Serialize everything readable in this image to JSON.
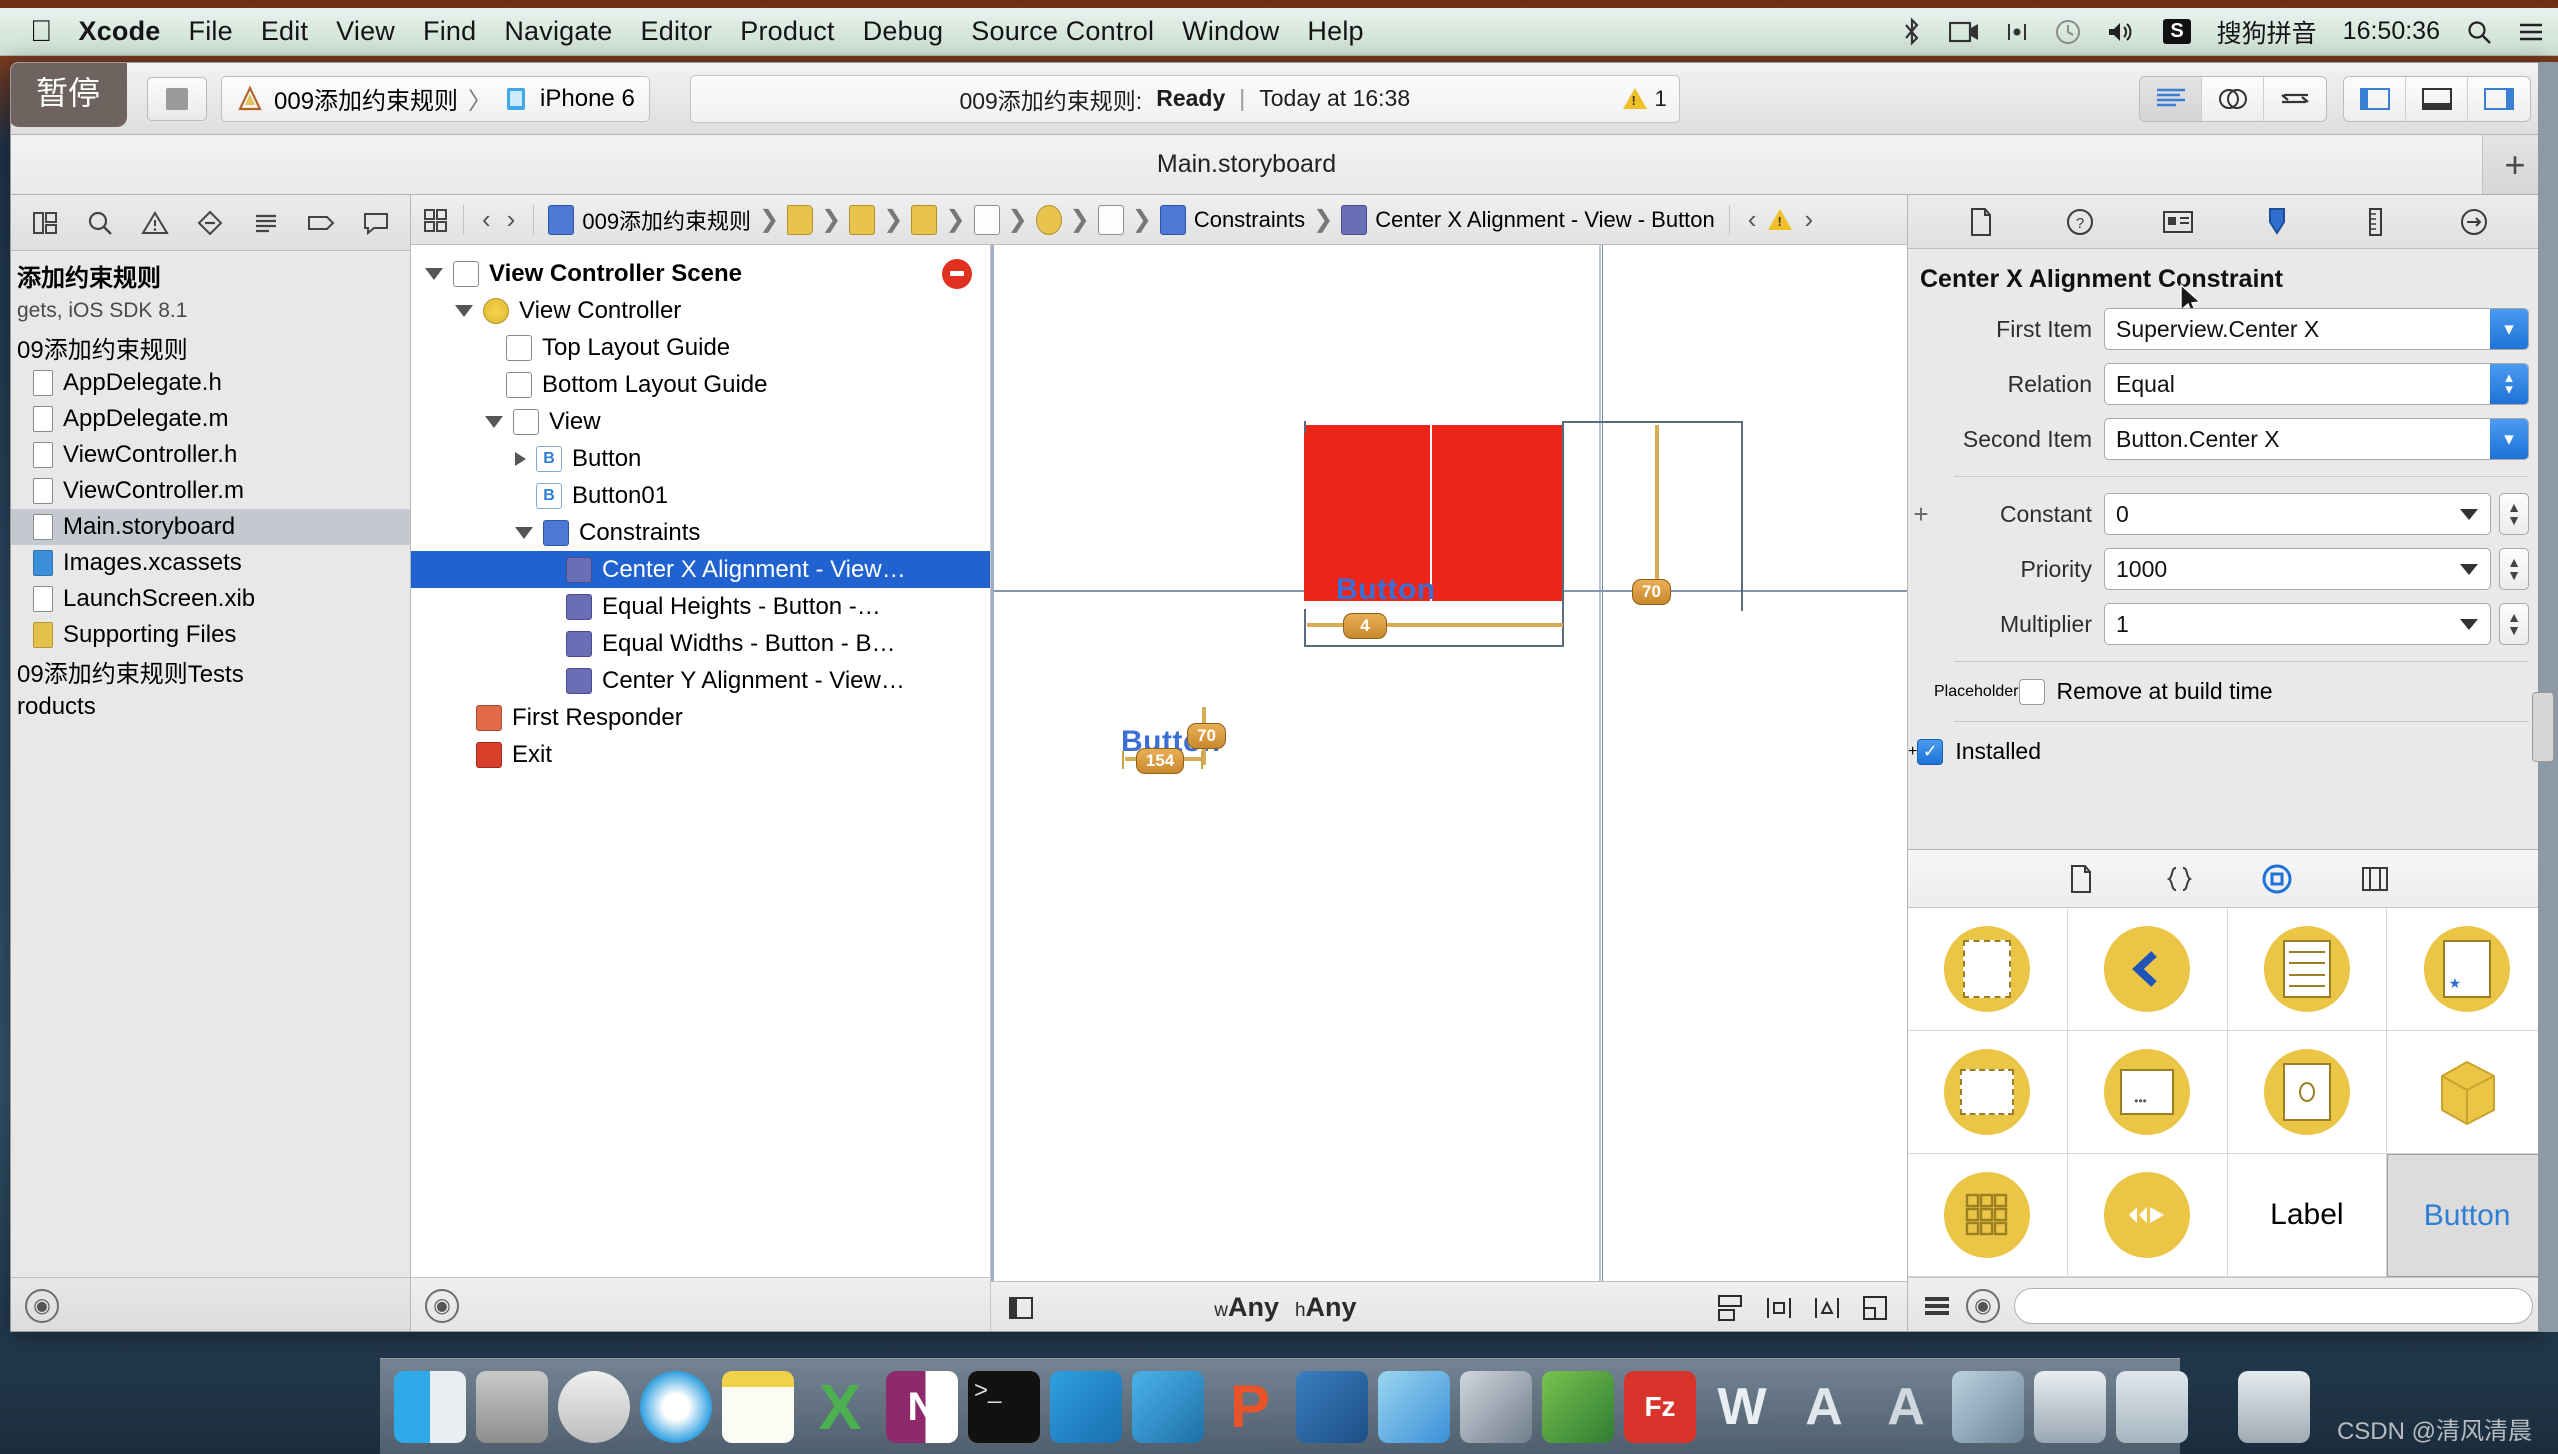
{
  "menubar": {
    "apple_icon": "apple-logo-icon",
    "items": [
      "Xcode",
      "File",
      "Edit",
      "View",
      "Find",
      "Navigate",
      "Editor",
      "Product",
      "Debug",
      "Source Control",
      "Window",
      "Help"
    ],
    "status_icons": [
      "bluetooth-icon",
      "screen-recording-icon",
      "airplay-icon",
      "time-machine-icon",
      "volume-icon"
    ],
    "input_method_badge": "S",
    "input_method": "搜狗拼音",
    "clock": "16:50:36",
    "search_icon": "spotlight-search-icon",
    "notification_icon": "notification-center-icon"
  },
  "tooltip": {
    "pause_label": "暂停"
  },
  "toolbar": {
    "stop_button": "stop-button",
    "scheme_project": "009添加约束规则",
    "scheme_separator": "〉",
    "scheme_device": "iPhone 6",
    "activity_project": "009添加约束规则:",
    "activity_status": "Ready",
    "activity_divider": "|",
    "activity_time": "Today at 16:38",
    "warning_count": "1",
    "editor_modes": [
      "standard-editor-icon",
      "assistant-editor-icon",
      "version-editor-icon"
    ],
    "view_toggles": [
      "toggle-navigator-icon",
      "toggle-debug-area-icon",
      "toggle-utilities-icon"
    ]
  },
  "tabbar": {
    "tab_title": "Main.storyboard",
    "add_tab": "+"
  },
  "navigator": {
    "tabs": [
      "project-navigator-icon",
      "search-navigator-icon",
      "issue-navigator-icon",
      "test-navigator-icon",
      "debug-navigator-icon",
      "breakpoint-navigator-icon",
      "report-navigator-icon"
    ],
    "items": [
      {
        "label": "添加约束规则",
        "kind": "project",
        "bold": true,
        "indent": 0
      },
      {
        "label": "gets, iOS SDK 8.1",
        "kind": "subtitle",
        "indent": 0
      },
      {
        "label": "09添加约束规则",
        "kind": "group",
        "indent": 0
      },
      {
        "label": "AppDelegate.h",
        "kind": "file",
        "indent": 1
      },
      {
        "label": "AppDelegate.m",
        "kind": "file",
        "indent": 1
      },
      {
        "label": "ViewController.h",
        "kind": "file",
        "indent": 1
      },
      {
        "label": "ViewController.m",
        "kind": "file",
        "indent": 1
      },
      {
        "label": "Main.storyboard",
        "kind": "file",
        "indent": 1,
        "selected": true
      },
      {
        "label": "Images.xcassets",
        "kind": "assets",
        "indent": 1
      },
      {
        "label": "LaunchScreen.xib",
        "kind": "file",
        "indent": 1
      },
      {
        "label": "Supporting Files",
        "kind": "folder",
        "indent": 1
      },
      {
        "label": "09添加约束规则Tests",
        "kind": "group",
        "indent": 0
      },
      {
        "label": "roducts",
        "kind": "group",
        "indent": 0
      }
    ],
    "filter_icon": "filter-icon"
  },
  "jumpbar": {
    "related_icon": "related-items-icon",
    "back": "‹",
    "forward": "›",
    "crumbs": [
      {
        "label": "009添加约束规则",
        "icon": "project-icon"
      },
      {
        "label": "",
        "icon": "folder-icon"
      },
      {
        "label": "",
        "icon": "file-icon"
      },
      {
        "label": "",
        "icon": "file-icon"
      },
      {
        "label": "",
        "icon": "scene-icon"
      },
      {
        "label": "",
        "icon": "view-controller-icon"
      },
      {
        "label": "",
        "icon": "view-icon"
      },
      {
        "label": "Constraints",
        "icon": "constraints-icon"
      },
      {
        "label": "Center X Alignment - View - Button",
        "icon": "constraint-icon"
      }
    ],
    "issue_prev": "‹",
    "issue_icon": "warning-icon",
    "issue_next": "›"
  },
  "outline": {
    "rows": [
      {
        "label": "View Controller Scene",
        "indent": 0,
        "disclosure": "open",
        "icon": "scene-icon",
        "bold": true,
        "badge": "stop-badge"
      },
      {
        "label": "View Controller",
        "indent": 1,
        "disclosure": "open",
        "icon": "view-controller-icon"
      },
      {
        "label": "Top Layout Guide",
        "indent": 2,
        "disclosure": "none",
        "icon": "top-layout-guide-icon"
      },
      {
        "label": "Bottom Layout Guide",
        "indent": 2,
        "disclosure": "none",
        "icon": "bottom-layout-guide-icon"
      },
      {
        "label": "View",
        "indent": 2,
        "disclosure": "open",
        "icon": "view-icon"
      },
      {
        "label": "Button",
        "indent": 3,
        "disclosure": "closed",
        "icon": "button-icon"
      },
      {
        "label": "Button01",
        "indent": 3,
        "disclosure": "none",
        "icon": "button-icon"
      },
      {
        "label": "Constraints",
        "indent": 3,
        "disclosure": "open",
        "icon": "constraints-icon"
      },
      {
        "label": "Center X Alignment - View…",
        "indent": 4,
        "disclosure": "none",
        "icon": "center-x-constraint-icon",
        "selected": true
      },
      {
        "label": "Equal Heights - Button -…",
        "indent": 4,
        "disclosure": "none",
        "icon": "equal-heights-constraint-icon"
      },
      {
        "label": "Equal Widths - Button - B…",
        "indent": 4,
        "disclosure": "none",
        "icon": "equal-widths-constraint-icon"
      },
      {
        "label": "Center Y Alignment - View…",
        "indent": 4,
        "disclosure": "none",
        "icon": "center-y-constraint-icon"
      },
      {
        "label": "First Responder",
        "indent": 1,
        "disclosure": "none",
        "icon": "first-responder-icon"
      },
      {
        "label": "Exit",
        "indent": 1,
        "disclosure": "none",
        "icon": "exit-icon"
      }
    ]
  },
  "canvas": {
    "top_button_label": "Button",
    "bottom_button_label": "Button",
    "badges": {
      "top_height": "70",
      "top_width": "4",
      "bottom_height": "70",
      "bottom_width": "154"
    },
    "size_class_w": "wAny",
    "size_class_h": "hAny",
    "size_class_prefix_w": "w",
    "size_class_prefix_h": "h",
    "autolayout_buttons": [
      "align-icon",
      "pin-icon",
      "resolve-auto-layout-issues-icon",
      "resizing-behavior-icon"
    ],
    "toggle_document_outline_icon": "toggle-document-outline-icon"
  },
  "inspector": {
    "tabs": [
      "file-inspector-icon",
      "quick-help-inspector-icon",
      "identity-inspector-icon",
      "attributes-inspector-icon",
      "size-inspector-icon",
      "connections-inspector-icon"
    ],
    "selected_tab": "attributes-inspector-icon",
    "title": "Center X Alignment Constraint",
    "fields": [
      {
        "label": "First Item",
        "value": "Superview.Center X",
        "control": "popup"
      },
      {
        "label": "Relation",
        "value": "Equal",
        "control": "popup"
      },
      {
        "label": "Second Item",
        "value": "Button.Center X",
        "control": "popup"
      }
    ],
    "numeric_fields": [
      {
        "label": "Constant",
        "value": "0",
        "control": "combo",
        "plus": true
      },
      {
        "label": "Priority",
        "value": "1000",
        "control": "combo",
        "plus": false
      },
      {
        "label": "Multiplier",
        "value": "1",
        "control": "combo",
        "plus": false
      }
    ],
    "placeholder_label": "Placeholder",
    "placeholder_option": "Remove at build time",
    "placeholder_checked": false,
    "installed_label": "Installed",
    "installed_checked": true,
    "cursor_icon": "mouse-cursor-icon"
  },
  "library": {
    "tabs": [
      "file-template-library-icon",
      "code-snippet-library-icon",
      "object-library-icon",
      "media-library-icon"
    ],
    "selected_tab": "object-library-icon",
    "cells": [
      {
        "icon": "container-view-icon",
        "text": ""
      },
      {
        "icon": "navigation-item-icon",
        "text": ""
      },
      {
        "icon": "table-view-icon",
        "text": ""
      },
      {
        "icon": "tab-bar-item-icon",
        "text": ""
      },
      {
        "icon": "view-icon",
        "text": ""
      },
      {
        "icon": "scroll-view-icon",
        "text": ""
      },
      {
        "icon": "image-view-icon",
        "text": ""
      },
      {
        "icon": "object-icon",
        "text": ""
      },
      {
        "icon": "collection-view-icon",
        "text": ""
      },
      {
        "icon": "player-controls-icon",
        "text": ""
      },
      {
        "icon": "label-icon",
        "text": "Label"
      },
      {
        "icon": "button-icon",
        "text": "Button",
        "selected": true
      }
    ],
    "list_view_icon": "list-view-icon",
    "filter_icon": "filter-icon",
    "resize_icon": "resize-handle-icon"
  },
  "dock": {
    "icons": [
      "finder-icon",
      "system-preferences-icon",
      "launchpad-icon",
      "safari-icon",
      "notes-icon",
      "excel-icon",
      "onenote-icon",
      "terminal-icon",
      "xcode-icon",
      "simulator-icon",
      "perl-icon",
      "snip-icon",
      "photos-icon",
      "video-icon",
      "graph-icon",
      "filezilla-icon",
      "w-icon",
      "a-icon",
      "a2-icon",
      "image-icon",
      "screens-icon",
      "folder-icon",
      "trash-icon"
    ]
  },
  "watermark": {
    "text": "CSDN @清风清晨"
  }
}
